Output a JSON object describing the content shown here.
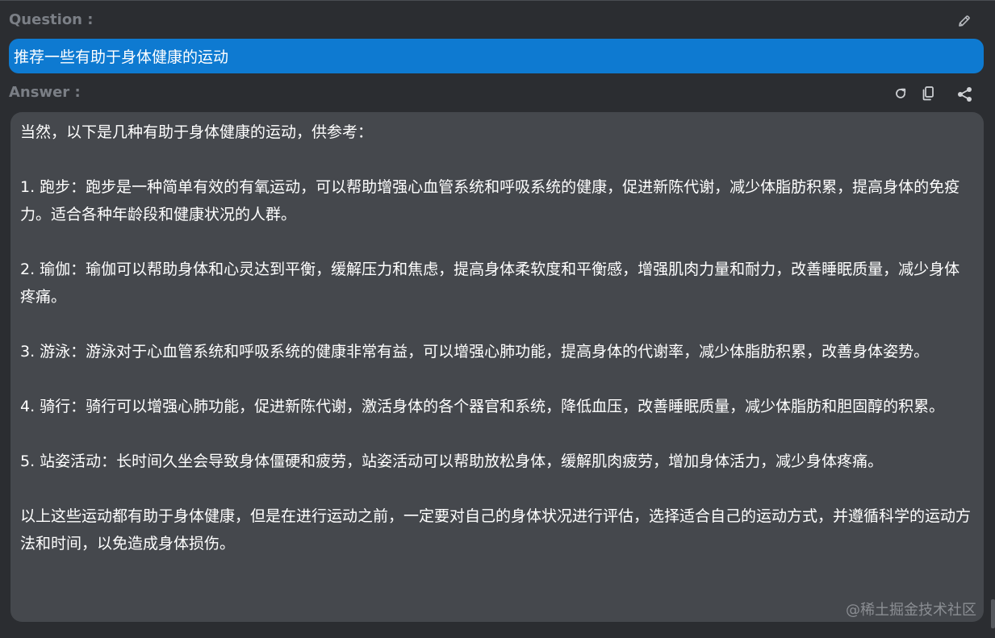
{
  "question": {
    "label": "Question :",
    "text": "推荐一些有助于身体健康的运动",
    "edit_icon": "pencil-icon"
  },
  "answer": {
    "label": "Answer :",
    "icons": [
      "refresh-icon",
      "copy-icon",
      "share-icon"
    ],
    "paragraphs": [
      "当然，以下是几种有助于身体健康的运动，供参考：",
      "1. 跑步：跑步是一种简单有效的有氧运动，可以帮助增强心血管系统和呼吸系统的健康，促进新陈代谢，减少体脂肪积累，提高身体的免疫力。适合各种年龄段和健康状况的人群。",
      "2. 瑜伽：瑜伽可以帮助身体和心灵达到平衡，缓解压力和焦虑，提高身体柔软度和平衡感，增强肌肉力量和耐力，改善睡眠质量，减少身体疼痛。",
      "3. 游泳：游泳对于心血管系统和呼吸系统的健康非常有益，可以增强心肺功能，提高身体的代谢率，减少体脂肪积累，改善身体姿势。",
      "4. 骑行：骑行可以增强心肺功能，促进新陈代谢，激活身体的各个器官和系统，降低血压，改善睡眠质量，减少体脂肪和胆固醇的积累。",
      "5. 站姿活动：长时间久坐会导致身体僵硬和疲劳，站姿活动可以帮助放松身体，缓解肌肉疲劳，增加身体活力，减少身体疼痛。",
      "以上这些运动都有助于身体健康，但是在进行运动之前，一定要对自己的身体状况进行评估，选择适合自己的运动方式，并遵循科学的运动方法和时间，以免造成身体损伤。"
    ]
  },
  "watermark": "@稀土掘金技术社区",
  "colors": {
    "background": "#2b2d31",
    "question_bg": "#0e7ad1",
    "answer_bg": "#45484d",
    "label": "#7b7f86"
  }
}
